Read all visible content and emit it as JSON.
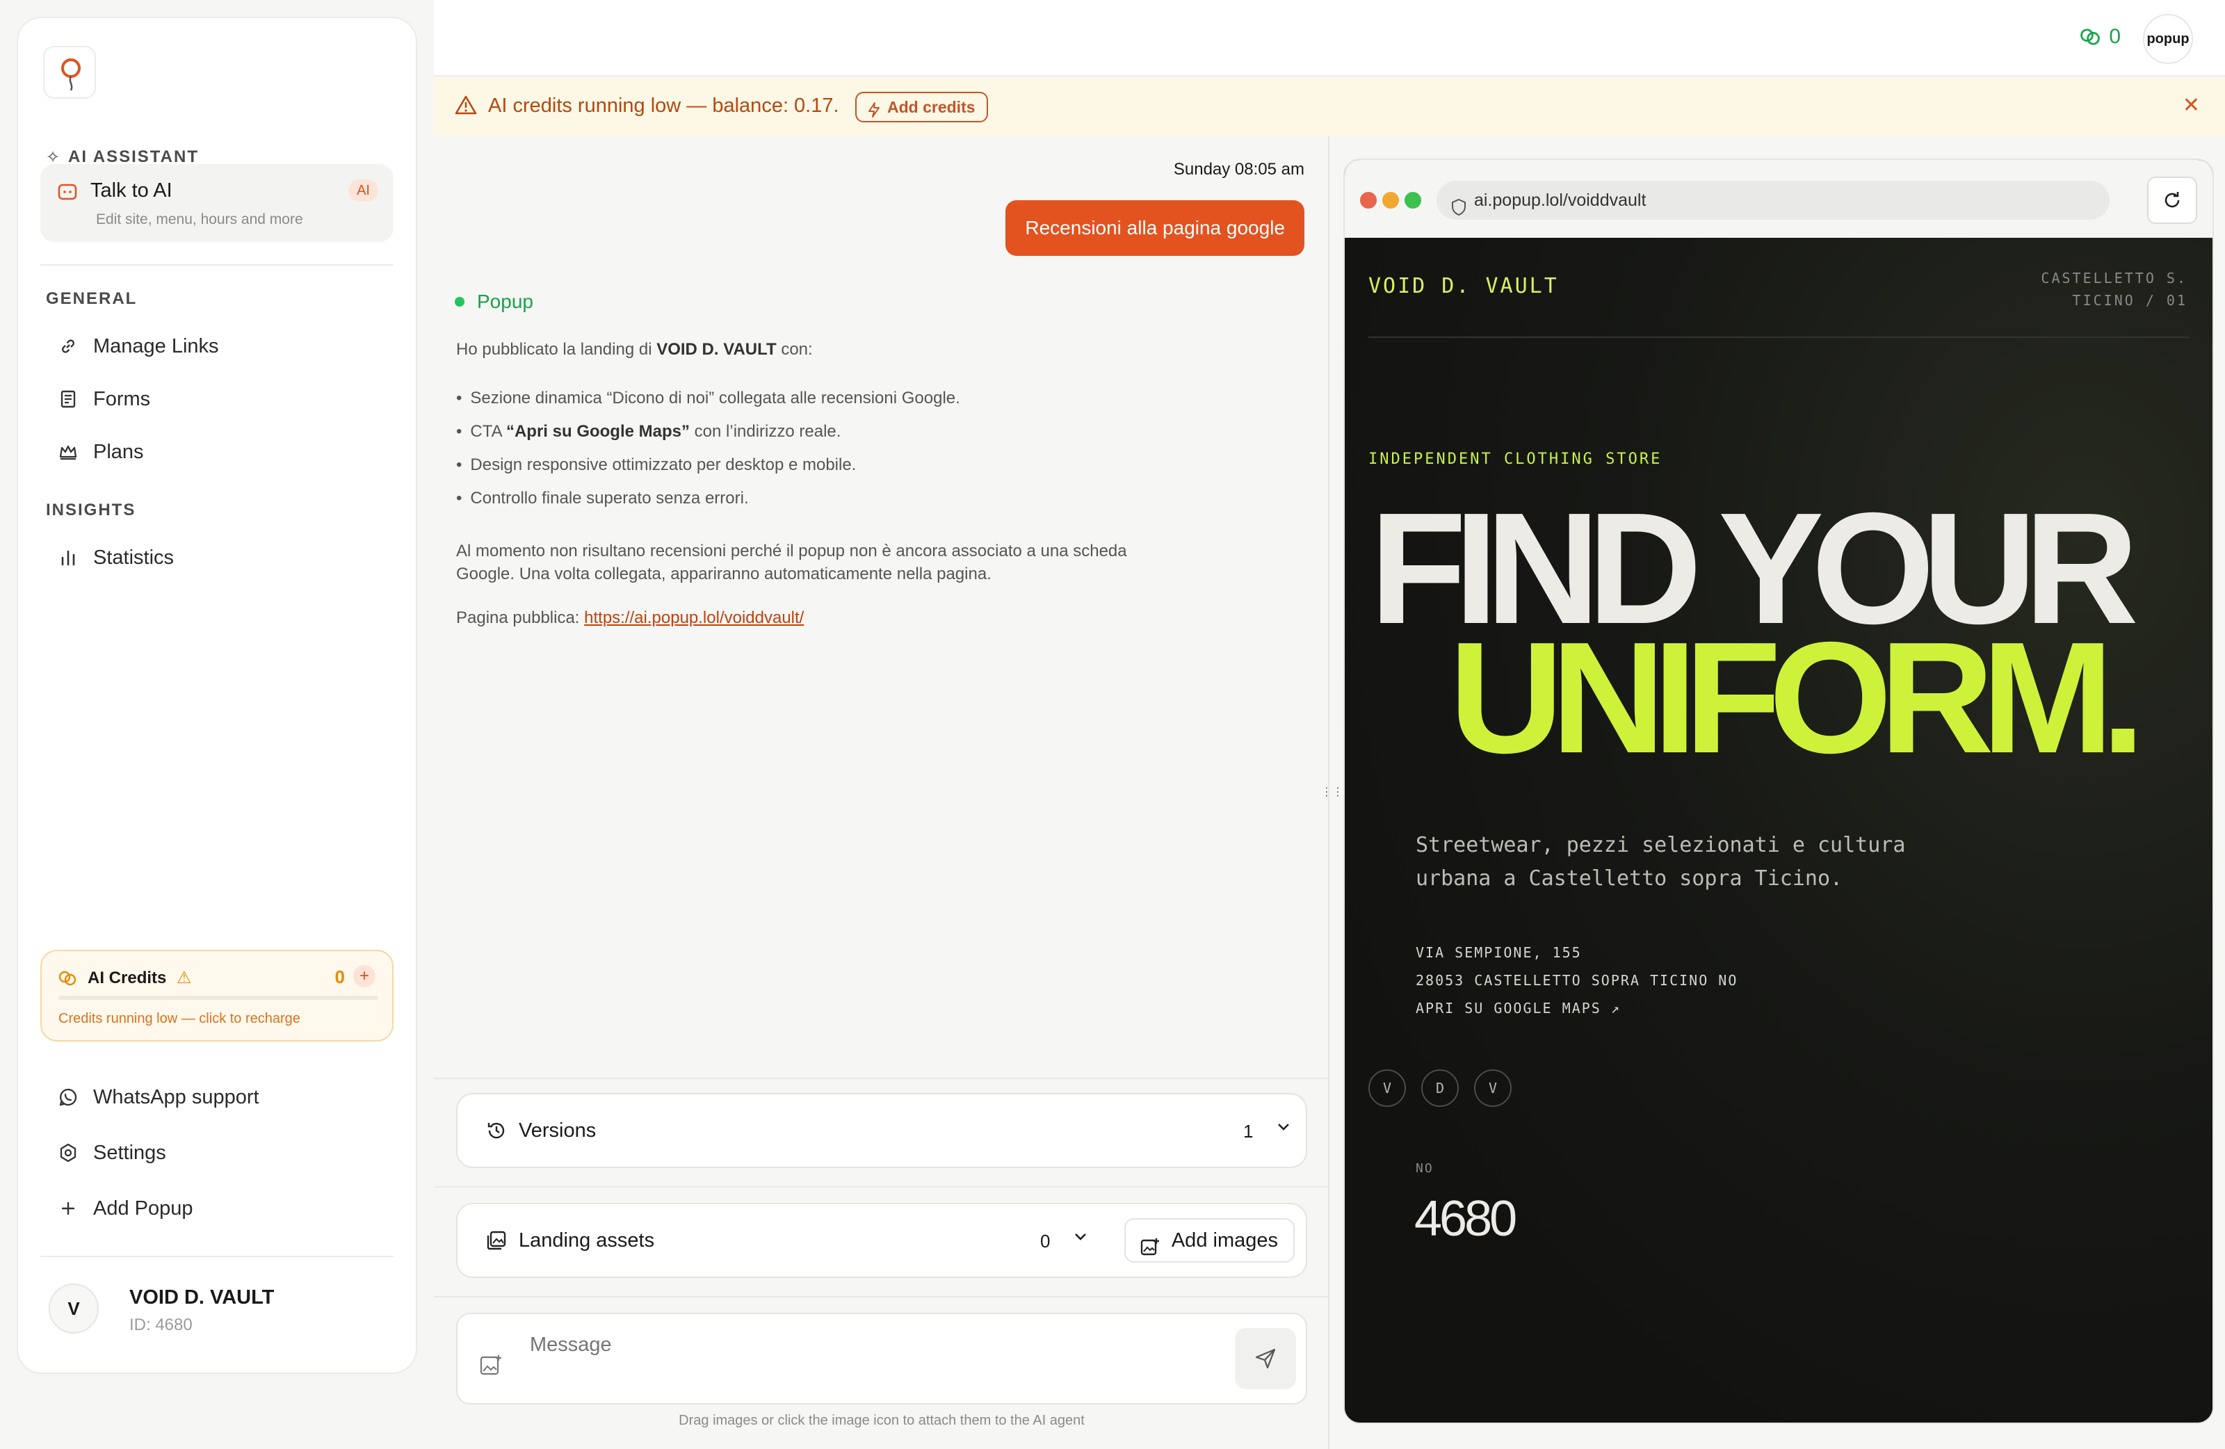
{
  "sidebar": {
    "ai_section_label": "AI ASSISTANT",
    "talk": {
      "title": "Talk to AI",
      "subtitle": "Edit site, menu, hours and more",
      "badge": "AI"
    },
    "general_label": "GENERAL",
    "general_items": [
      {
        "label": "Manage Links",
        "icon": "link-icon"
      },
      {
        "label": "Forms",
        "icon": "forms-icon"
      },
      {
        "label": "Plans",
        "icon": "crown-icon"
      }
    ],
    "insights_label": "INSIGHTS",
    "insights_items": [
      {
        "label": "Statistics",
        "icon": "bar-chart-icon"
      }
    ],
    "credits": {
      "title": "AI Credits",
      "count": "0",
      "note": "Credits running low — click to recharge"
    },
    "bottom_items": [
      {
        "label": "WhatsApp support",
        "icon": "whatsapp-icon"
      },
      {
        "label": "Settings",
        "icon": "settings-icon"
      },
      {
        "label": "Add Popup",
        "icon": "plus-icon"
      }
    ],
    "account": {
      "initial": "V",
      "name": "VOID D. VAULT",
      "id": "ID: 4680"
    }
  },
  "topbar": {
    "credits": "0",
    "avatar_text": "popup"
  },
  "banner": {
    "text": "AI credits running low — balance: 0.17.",
    "button": "Add credits"
  },
  "chat": {
    "timestamp": "Sunday 08:05 am",
    "user_message": "Recensioni alla pagina google",
    "bot_name": "Popup",
    "intro_prefix": "Ho pubblicato la landing di ",
    "intro_brand": "VOID D. VAULT",
    "intro_suffix": " con:",
    "bullets": [
      {
        "pre": "Sezione dinamica “Dicono di noi” collegata alle recensioni Google.",
        "bold": "",
        "post": ""
      },
      {
        "pre": "CTA ",
        "bold": "“Apri su Google Maps”",
        "post": " con l’indirizzo reale."
      },
      {
        "pre": "Design responsive ottimizzato per desktop e mobile.",
        "bold": "",
        "post": ""
      },
      {
        "pre": "Controllo finale superato senza errori.",
        "bold": "",
        "post": ""
      }
    ],
    "note_line1": "Al momento non risultano recensioni perché il popup non è ancora associato a una scheda",
    "note_line2": "Google. Una volta collegata, appariranno automaticamente nella pagina.",
    "public_label": "Pagina pubblica: ",
    "public_url": "https://ai.popup.lol/voiddvault/"
  },
  "versions": {
    "title": "Versions",
    "count": "1"
  },
  "assets": {
    "title": "Landing assets",
    "count": "0",
    "button": "Add images"
  },
  "composer": {
    "placeholder": "Message",
    "hint": "Drag images or click the image icon to attach them to the AI agent"
  },
  "preview": {
    "url": "ai.popup.lol/voiddvault",
    "site": {
      "brand": "VOID D. VAULT",
      "location_line1": "CASTELLETTO S.",
      "location_line2": "TICINO / 01",
      "tagline": "INDEPENDENT CLOTHING STORE",
      "hero_line1": "FIND YOUR",
      "hero_line2": "UNIFORM.",
      "description": "Streetwear, pezzi selezionati e cultura urbana a Castelletto sopra Ticino.",
      "address_line1": "VIA SEMPIONE, 155",
      "address_line2": "28053 CASTELLETTO SOPRA TICINO NO",
      "maps_link": "APRI SU GOOGLE MAPS ↗",
      "circles": [
        "V",
        "D",
        "V"
      ],
      "province_label": "NO",
      "number": "4680"
    }
  },
  "colors": {
    "accent": "#e2531f",
    "success": "#16a34a",
    "lime": "#cef23a",
    "warning_bg": "#fdf8e6"
  }
}
